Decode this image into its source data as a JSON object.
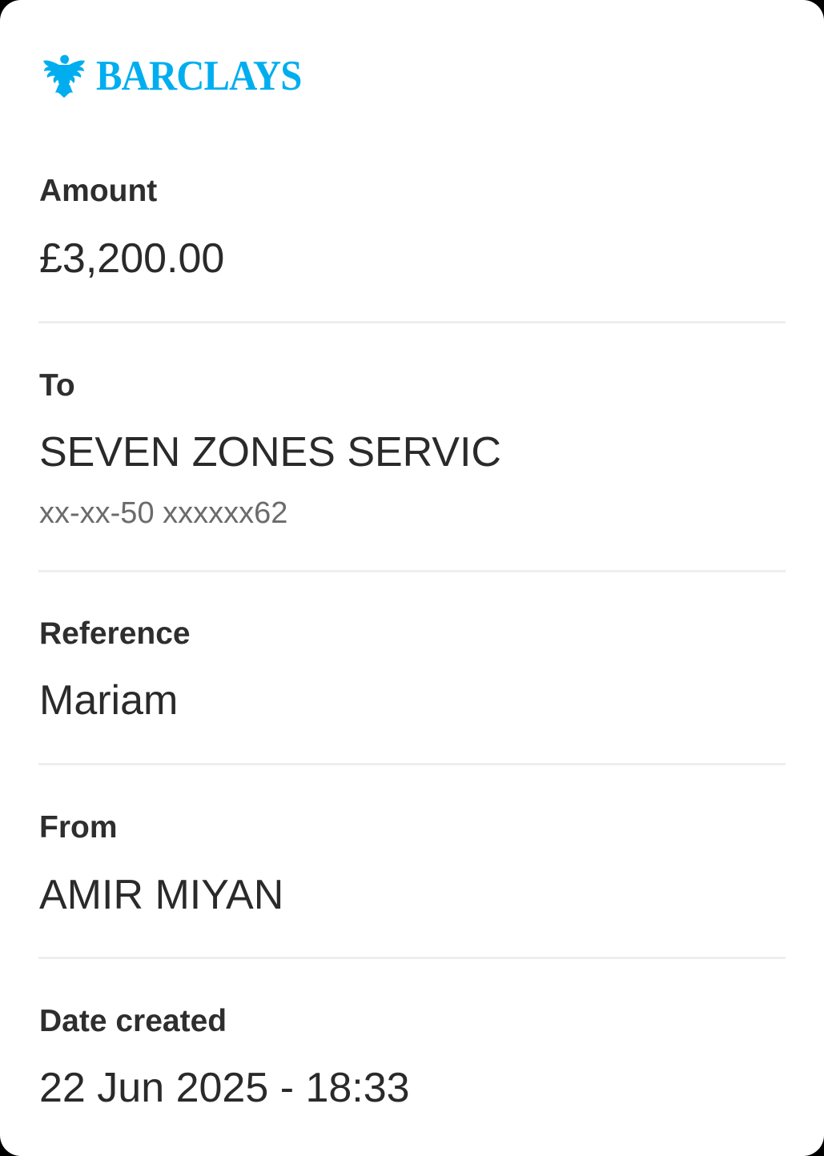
{
  "brand": {
    "name": "BARCLAYS",
    "logo_icon": "eagle-icon",
    "color": "#00aeef"
  },
  "details": {
    "amount": {
      "label": "Amount",
      "value": "£3,200.00"
    },
    "to": {
      "label": "To",
      "value": "SEVEN ZONES SERVIC",
      "account": "xx-xx-50 xxxxxx62"
    },
    "reference": {
      "label": "Reference",
      "value": "Mariam"
    },
    "from": {
      "label": "From",
      "value": "AMIR MIYAN"
    },
    "date_created": {
      "label": "Date created",
      "value": "22 Jun 2025 - 18:33"
    }
  }
}
